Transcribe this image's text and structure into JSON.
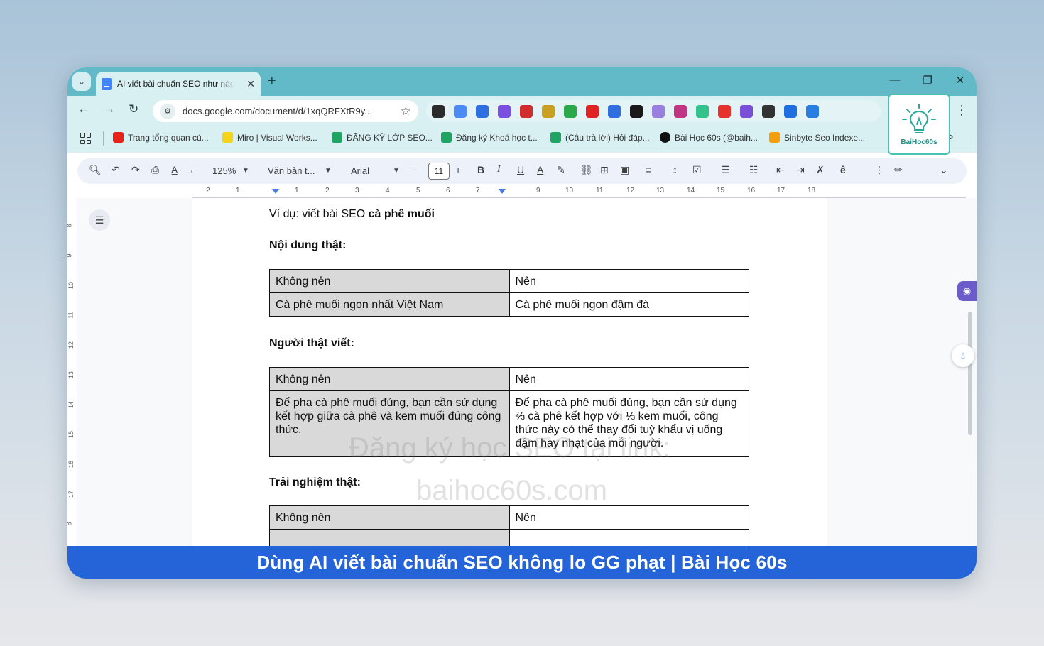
{
  "browser": {
    "tab_title": "AI viết bài chuẩn SEO như nào",
    "tab_close": "✕",
    "new_tab": "+",
    "url": "docs.google.com/document/d/1xqQRFXtR9y...",
    "bookmarks": [
      {
        "label": "Trang tổng quan cú...",
        "icon": "youtube-icon",
        "color": "#e62117"
      },
      {
        "label": "Miro | Visual Works...",
        "icon": "miro-icon",
        "color": "#f7d21a"
      },
      {
        "label": "ĐĂNG KÝ LỚP SEO...",
        "icon": "sheets-icon",
        "color": "#1fa463"
      },
      {
        "label": "Đăng ký Khoá học t...",
        "icon": "sheets-icon",
        "color": "#1fa463"
      },
      {
        "label": "(Câu trả lời) Hỏi đáp...",
        "icon": "sheets-icon",
        "color": "#1fa463"
      },
      {
        "label": "Bài Học 60s (@baih...",
        "icon": "tiktok-icon",
        "color": "#111111"
      },
      {
        "label": "Sinbyte Seo Indexe...",
        "icon": "sinbyte-icon",
        "color": "#f59e0b"
      }
    ],
    "extensions": [
      {
        "icon": "ext-dark-circle-icon",
        "color": "#2b2b2b"
      },
      {
        "icon": "ext-docs-icon",
        "color": "#4c8bf5"
      },
      {
        "icon": "ext-tag-icon",
        "color": "#2f6fe0"
      },
      {
        "icon": "ext-gear-icon",
        "color": "#7b4fe0"
      },
      {
        "icon": "ext-seo-icon",
        "color": "#d22d2d"
      },
      {
        "icon": "ext-robot-icon",
        "color": "#c9a021"
      },
      {
        "icon": "ext-200-icon",
        "color": "#2aa84a"
      },
      {
        "icon": "ext-new-icon",
        "color": "#e02424"
      },
      {
        "icon": "ext-tag2-icon",
        "color": "#2f6fe0"
      },
      {
        "icon": "ext-f-icon",
        "color": "#1a1a1a"
      },
      {
        "icon": "ext-link-icon",
        "color": "#9b7fe0"
      },
      {
        "icon": "ext-instagram-icon",
        "color": "#c13584"
      },
      {
        "icon": "ext-g-icon",
        "color": "#34c28c"
      },
      {
        "icon": "ext-acrobat-icon",
        "color": "#e5322d"
      },
      {
        "icon": "ext-purple-icon",
        "color": "#7a4fd8"
      },
      {
        "icon": "ext-c-icon",
        "color": "#333333"
      },
      {
        "icon": "ext-bars-icon",
        "color": "#1f6fe0"
      },
      {
        "icon": "ext-m-icon",
        "color": "#2a7de1"
      }
    ],
    "logo_text": "BaiHoc60s"
  },
  "docs_toolbar": {
    "zoom": "125%",
    "style": "Văn bản t...",
    "font": "Arial",
    "font_size": "11"
  },
  "ruler": {
    "numbers": [
      "2",
      "1",
      "1",
      "2",
      "3",
      "4",
      "5",
      "6",
      "7",
      "9",
      "10",
      "11",
      "12",
      "13",
      "14",
      "15",
      "16",
      "17",
      "18"
    ],
    "left_numbers": [
      "8",
      "9",
      "10",
      "11",
      "12",
      "13",
      "14",
      "15",
      "16",
      "17",
      "8"
    ]
  },
  "document": {
    "example_prefix": "Ví dụ: viết bài SEO ",
    "example_bold": "cà phê muối",
    "heading1": "Nội dung thật:",
    "table1": {
      "header": [
        "Không nên",
        "Nên"
      ],
      "row": [
        "Cà phê muối ngon nhất Việt Nam",
        "Cà phê muối ngon đậm đà"
      ]
    },
    "heading2": "Người thật viết:",
    "table2": {
      "header": [
        "Không nên",
        "Nên"
      ],
      "row": [
        "Để pha cà phê muối đúng, bạn cần sử dụng kết hợp giữa cà phê và kem muối đúng công thức.",
        "Để pha cà phê muối đúng, bạn cần sử dụng ⅔ cà phê kết hợp với ⅓ kem muối, công thức này có thể thay đổi tuỳ khẩu vị uống đậm hay nhạt của mỗi người."
      ]
    },
    "heading3": "Trải nghiệm thật:",
    "table3": {
      "header": [
        "Không nên",
        "Nên"
      ]
    },
    "watermark_line1": "Đăng ký học SEO tại link:",
    "watermark_line2": "baihoc60s.com"
  },
  "banner": {
    "text": "Dùng AI viết bài chuẩn SEO không lo GG phạt | Bài Học 60s",
    "color": "#2563d8"
  }
}
